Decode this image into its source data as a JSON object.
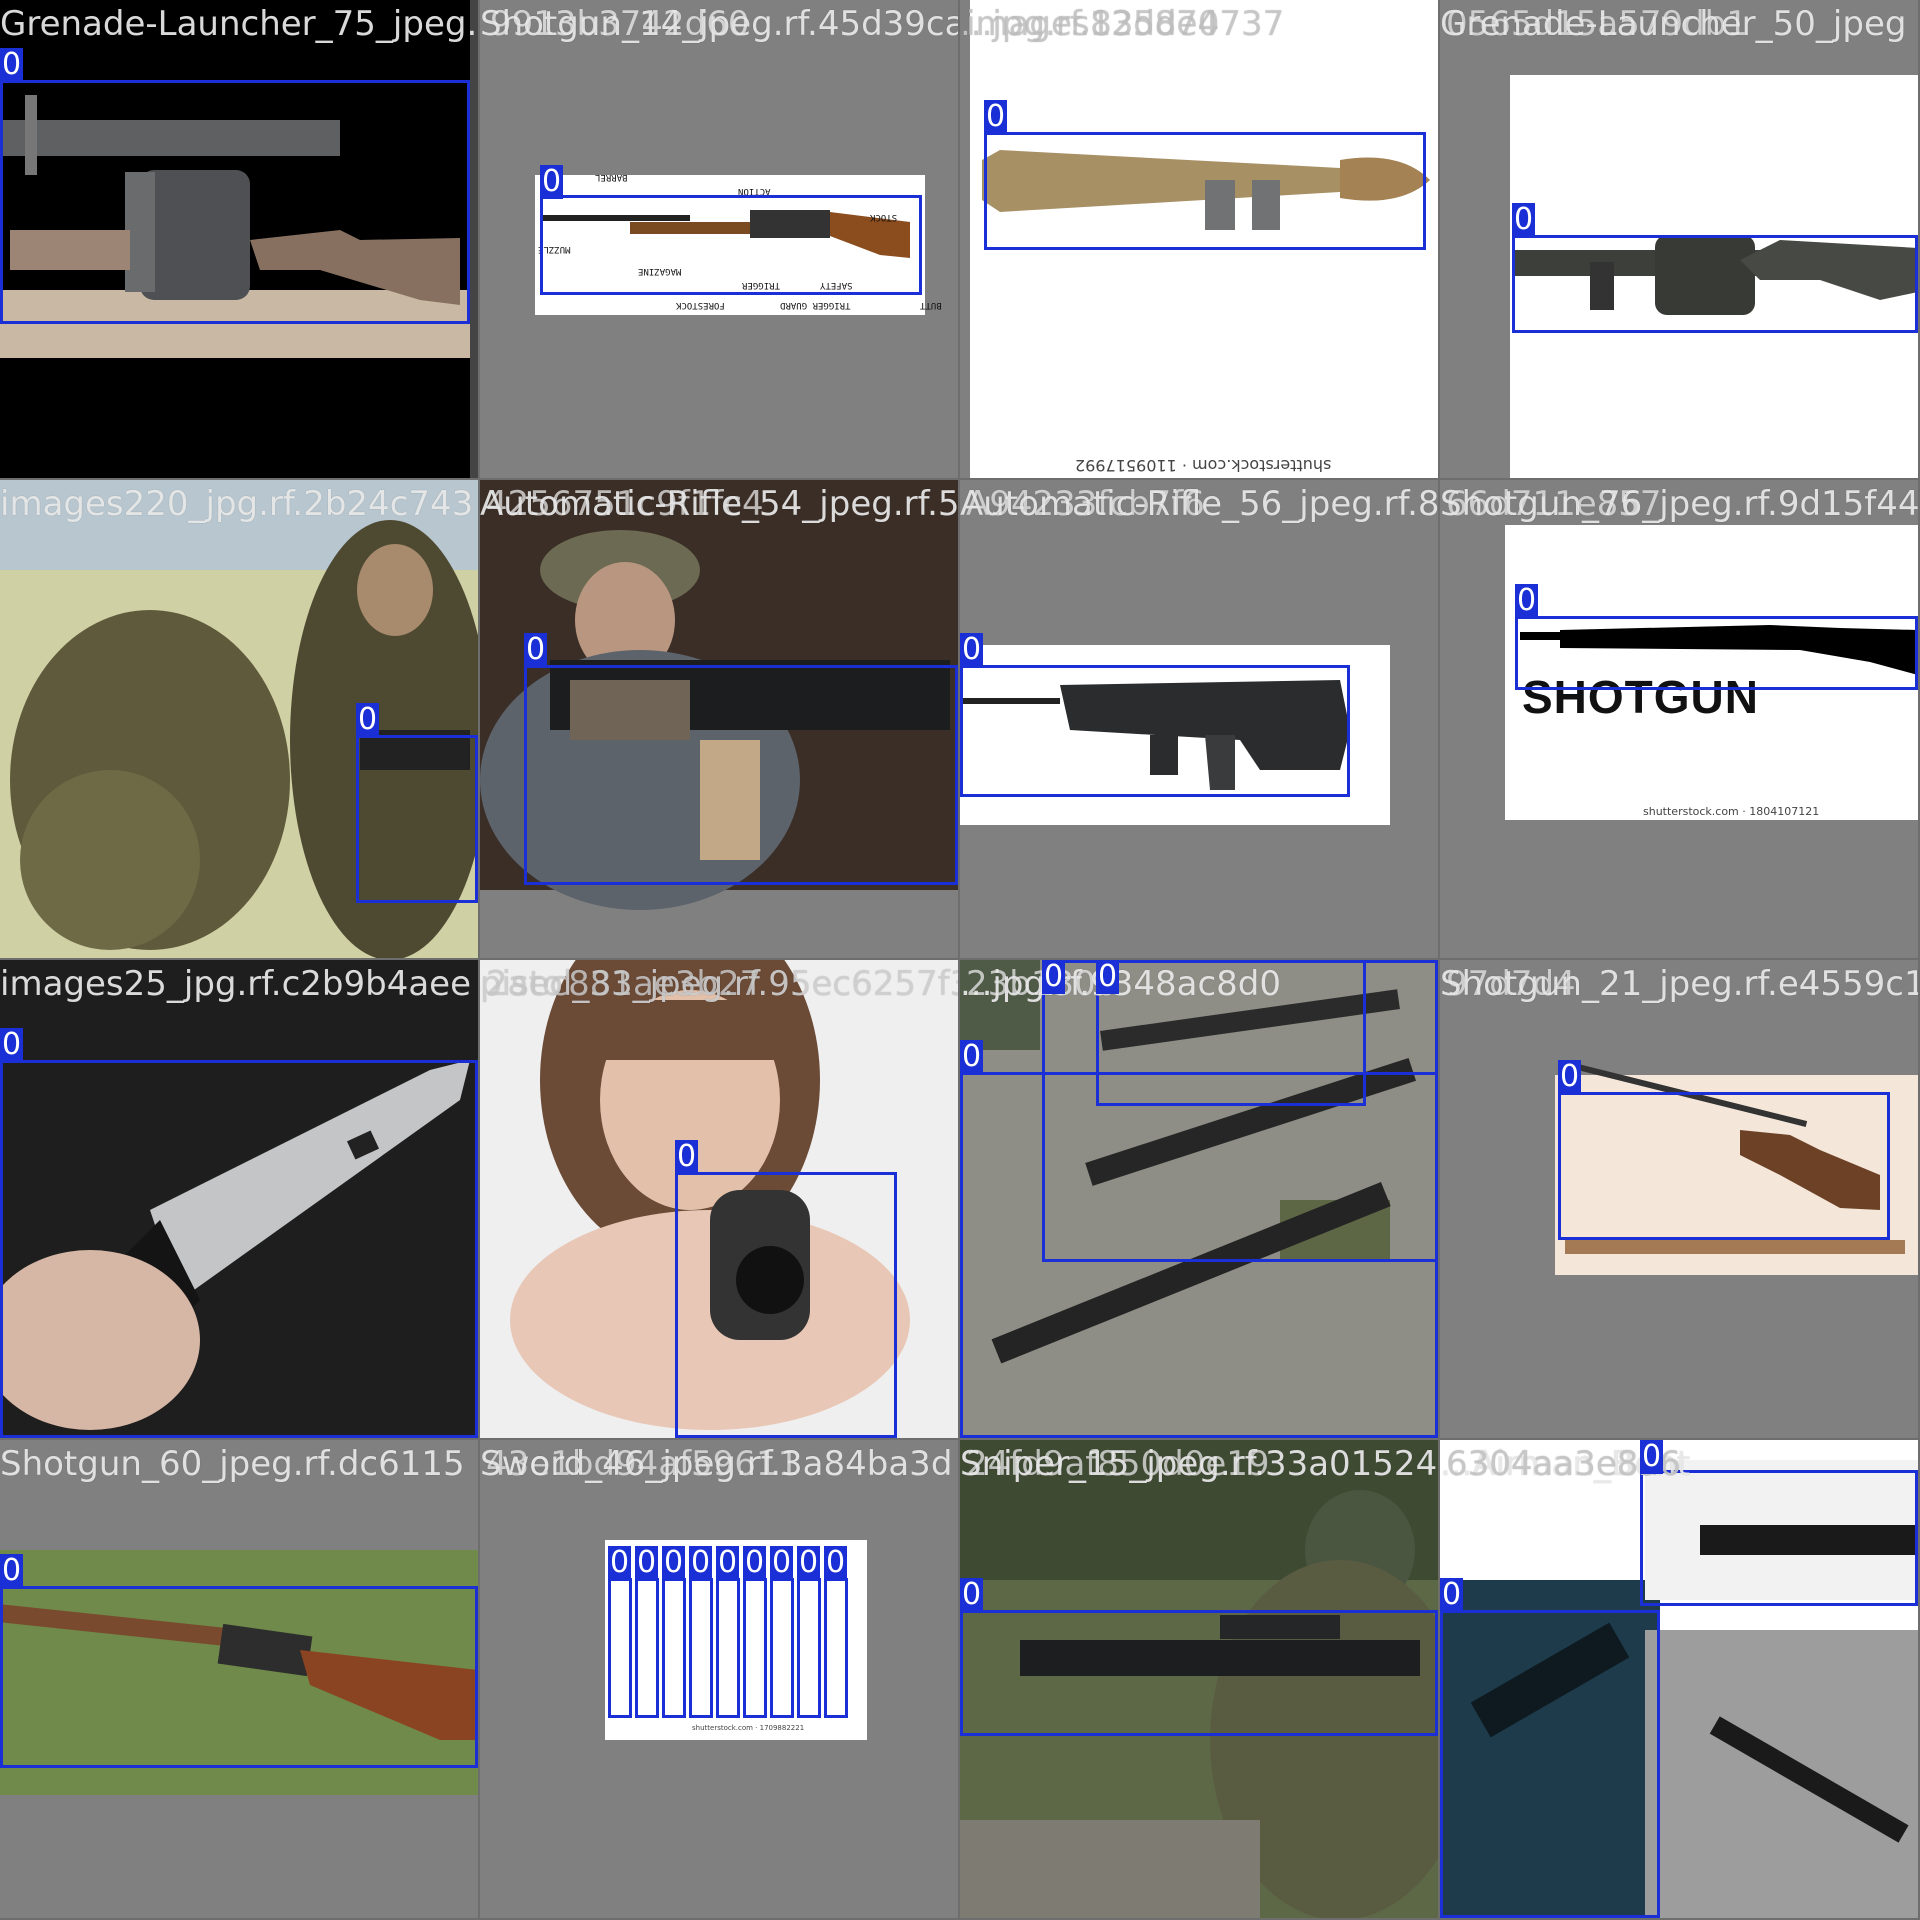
{
  "tiles": [
    {
      "filename": "Grenade-Launcher_75_jpeg.rf.",
      "class_tag": "0"
    },
    {
      "filename": "Shotgun_14_jpeg.rf.45d39ca",
      "class_tag": "0",
      "overlay": "9913b3742d60",
      "parts": [
        "BARREL",
        "ACTION",
        "STOCK",
        "MUZZLE",
        "MAGAZINE",
        "TRIGGER",
        "SAFETY",
        "FORESTOCK",
        "TRIGGER GUARD",
        "BUTT"
      ]
    },
    {
      "filename": "...jpg.rf.83dde4",
      "class_tag": "0",
      "overlay": "images125870737",
      "watermark": "shutterstock.com · 1109517992"
    },
    {
      "filename": "Grenade-Launcher_50_jpeg",
      "class_tag": "0",
      "overlay": "0565d15a579db1"
    },
    {
      "filename": "images220_jpg.rf.2b24c743",
      "class_tag": "0"
    },
    {
      "filename": "Automatic-Rifle_54_jpeg.rf.5",
      "class_tag": "0",
      "overlay": "4256751c9f1fc4"
    },
    {
      "filename": "Automatic-Rifle_56_jpeg.rf.8",
      "class_tag": "0",
      "overlay": "A94233fcb7f6"
    },
    {
      "filename": "Shotgun_76_jpeg.rf.9d15f44",
      "class_tag": "0",
      "overlay": "66d711e857",
      "label_text": "SHOTGUN",
      "watermark": "shutterstock.com · 1804107121"
    },
    {
      "filename": "images25_jpg.rf.c2b9b4aee",
      "class_tag": "0"
    },
    {
      "filename": "pistol_33_jpeg.rf.95ec6257f3",
      "class_tag": "0",
      "overlay": "2aec881ae3b27"
    },
    {
      "filename": "...jpg.rf.9348ac8d0",
      "class_tag": "0",
      "overlay": "23b1300"
    },
    {
      "filename": "Shotgun_21_jpeg.rf.e4559c1",
      "class_tag": "0",
      "overlay": "97d7d4"
    },
    {
      "filename": "Shotgun_60_jpeg.rf.dc6115",
      "class_tag": "0"
    },
    {
      "filename": "Sword_46_jpeg.rf.3a84ba3d",
      "class_tag": "0",
      "overlay": "43e1bd94af59611",
      "watermark": "shutterstock.com · 1709882221"
    },
    {
      "filename": "Sniper_15_jpeg.rf.33a01524",
      "class_tag": "0",
      "overlay": "24fd9af850d0e19"
    },
    {
      "filename": "...Airman_Bent",
      "class_tag": "0",
      "overlay": "6304aa3e8a6"
    }
  ]
}
